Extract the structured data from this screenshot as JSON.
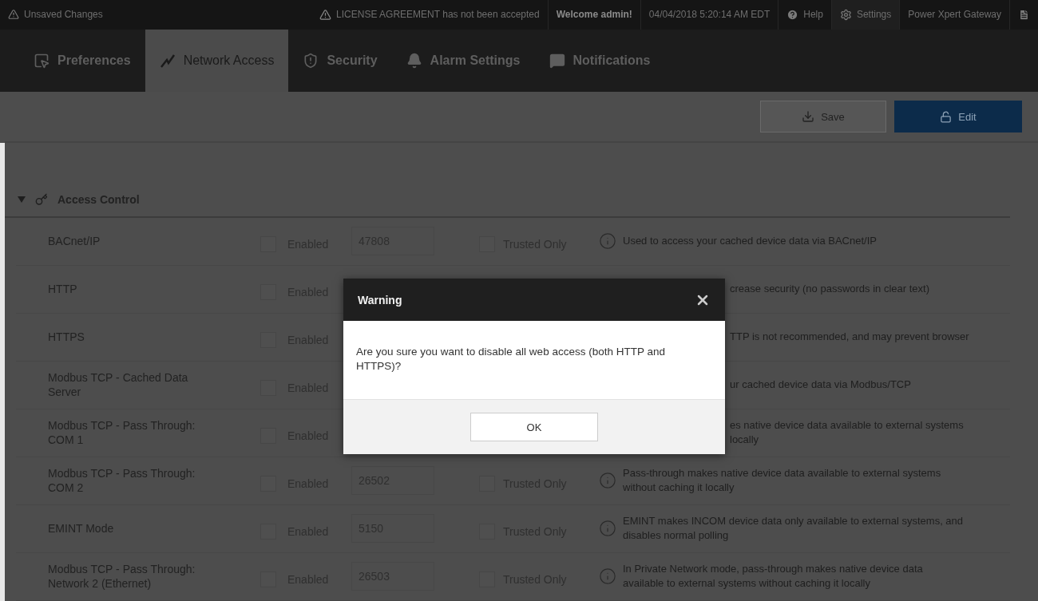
{
  "top_bar": {
    "unsaved": "Unsaved Changes",
    "license": "LICENSE AGREEMENT has not been accepted",
    "welcome": "Welcome admin!",
    "datetime": "04/04/2018 5:20:14 AM EDT",
    "help": "Help",
    "settings": "Settings",
    "product": "Power Xpert Gateway"
  },
  "tabs": [
    {
      "kind": "preferences",
      "label": "Preferences",
      "selected": false
    },
    {
      "kind": "network",
      "label": "Network Access",
      "selected": true
    },
    {
      "kind": "security",
      "label": "Security",
      "selected": false
    },
    {
      "kind": "alarm",
      "label": "Alarm Settings",
      "selected": false
    },
    {
      "kind": "notifications",
      "label": "Notifications",
      "selected": false
    }
  ],
  "toolbar": {
    "save": "Save",
    "edit": "Edit"
  },
  "section": {
    "title": "Access Control",
    "expanded": true
  },
  "rows": [
    {
      "kind": "full",
      "name": "BACnet/IP",
      "enabled": {
        "label": "Enabled",
        "checked": false
      },
      "port": "47808",
      "trusted": {
        "label": "Trusted Only",
        "checked": false
      },
      "description": [
        "Used to access your cached device data via BACnet/IP"
      ]
    },
    {
      "kind": "covered",
      "name": "HTTP",
      "enabled": {
        "label": "Enabled",
        "checked": false
      },
      "description": [
        "crease security (no passwords in clear text)"
      ]
    },
    {
      "kind": "covered",
      "name": "HTTPS",
      "enabled": {
        "label": "Enabled",
        "checked": false
      },
      "description": [
        "TTP is not recommended, and may prevent browser"
      ]
    },
    {
      "kind": "covered",
      "name": "Modbus TCP - Cached Data Server",
      "enabled": {
        "label": "Enabled",
        "checked": false
      },
      "description": [
        "ur cached device data via Modbus/TCP"
      ]
    },
    {
      "kind": "covered",
      "name": "Modbus TCP - Pass Through: COM 1",
      "enabled": {
        "label": "Enabled",
        "checked": false
      },
      "description": [
        "es native device data available to external systems",
        "locally"
      ]
    },
    {
      "kind": "full",
      "name": "Modbus TCP - Pass Through: COM 2",
      "enabled": {
        "label": "Enabled",
        "checked": false
      },
      "port": "26502",
      "trusted": {
        "label": "Trusted Only",
        "checked": false
      },
      "description": [
        "Pass-through makes native device data available to external systems",
        "without caching it locally"
      ]
    },
    {
      "kind": "full",
      "name": "EMINT Mode",
      "enabled": {
        "label": "Enabled",
        "checked": false
      },
      "port": "5150",
      "trusted": {
        "label": "Trusted Only",
        "checked": false
      },
      "description": [
        "EMINT makes INCOM device data only available to external systems, and",
        "disables normal polling"
      ]
    },
    {
      "kind": "full",
      "name": "Modbus TCP - Pass Through: Network 2 (Ethernet)",
      "enabled": {
        "label": "Enabled",
        "checked": false
      },
      "port": "26503",
      "trusted": {
        "label": "Trusted Only",
        "checked": false
      },
      "description": [
        "In Private Network mode, pass-through makes native device data",
        "available to external systems without caching it locally"
      ]
    }
  ],
  "dialog": {
    "title": "Warning",
    "message": "Are you sure you want to disable all web access (both HTTP and HTTPS)?",
    "ok": "OK"
  }
}
